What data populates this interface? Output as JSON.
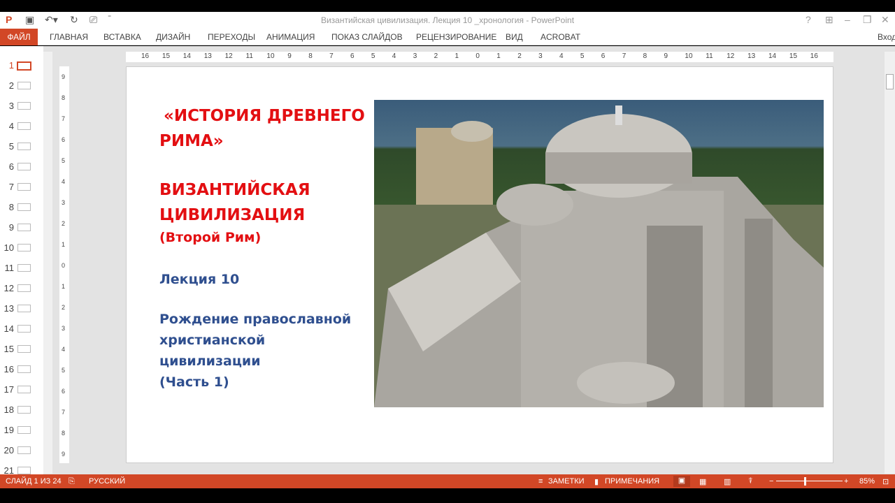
{
  "window": {
    "title": "Византийская цивилизация. Лекция 10 _хронология - PowerPoint",
    "signin": "Вход"
  },
  "ribbon": {
    "file": "ФАЙЛ",
    "tabs": [
      "ГЛАВНАЯ",
      "ВСТАВКА",
      "ДИЗАЙН",
      "ПЕРЕХОДЫ",
      "АНИМАЦИЯ",
      "ПОКАЗ СЛАЙДОВ",
      "РЕЦЕНЗИРОВАНИЕ",
      "ВИД",
      "ACROBAT"
    ]
  },
  "thumbnails": [
    "1",
    "2",
    "3",
    "4",
    "5",
    "6",
    "7",
    "8",
    "9",
    "10",
    "11",
    "12",
    "13",
    "14",
    "15",
    "16",
    "17",
    "18",
    "19",
    "20",
    "21"
  ],
  "hruler": [
    "16",
    "15",
    "14",
    "13",
    "12",
    "11",
    "10",
    "9",
    "8",
    "7",
    "6",
    "5",
    "4",
    "3",
    "2",
    "1",
    "0",
    "1",
    "2",
    "3",
    "4",
    "5",
    "6",
    "7",
    "8",
    "9",
    "10",
    "11",
    "12",
    "13",
    "14",
    "15",
    "16"
  ],
  "vruler": [
    "9",
    "8",
    "7",
    "6",
    "5",
    "4",
    "3",
    "2",
    "1",
    "0",
    "1",
    "2",
    "3",
    "4",
    "5",
    "6",
    "7",
    "8",
    "9"
  ],
  "slide": {
    "line1": "«ИСТОРИЯ ДРЕВНЕГО",
    "line2": "РИМА»",
    "line3": "ВИЗАНТИЙСКАЯ",
    "line4": "ЦИВИЛИЗАЦИЯ",
    "line5": "(Второй Рим)",
    "line6": "Лекция 10",
    "line7": "Рождение православной",
    "line8": "христианской",
    "line9": "цивилизации",
    "line10": "(Часть 1)"
  },
  "status": {
    "slide": "СЛАЙД 1 ИЗ 24",
    "lang": "РУССКИЙ",
    "notes": "ЗАМЕТКИ",
    "comments": "ПРИМЕЧАНИЯ",
    "zoom": "85%"
  },
  "colors": {
    "accent": "#d24726",
    "title_red": "#e30f12",
    "text_blue": "#2f4f8f"
  }
}
